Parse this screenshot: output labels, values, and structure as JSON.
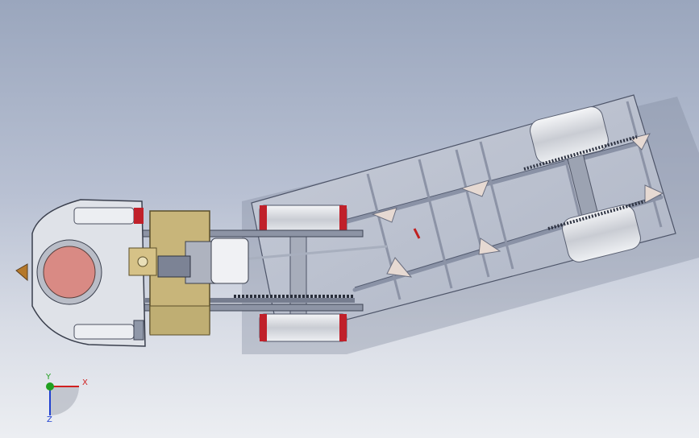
{
  "viewport": {
    "model": "traction-engine-assembly",
    "background_top": "#9aa6bd",
    "background_bottom": "#eceef2"
  },
  "colors": {
    "steel": "#b8bcc6",
    "frame": "#d8dce4",
    "tire_red": "#c0202a",
    "brass": "#c8b57a",
    "boiler_face": "#d98a84",
    "axis_x": "#d02020",
    "axis_y": "#20a020",
    "axis_z": "#2040d0"
  },
  "triad": {
    "x_label": "X",
    "y_label": "Y",
    "z_label": "Z"
  }
}
